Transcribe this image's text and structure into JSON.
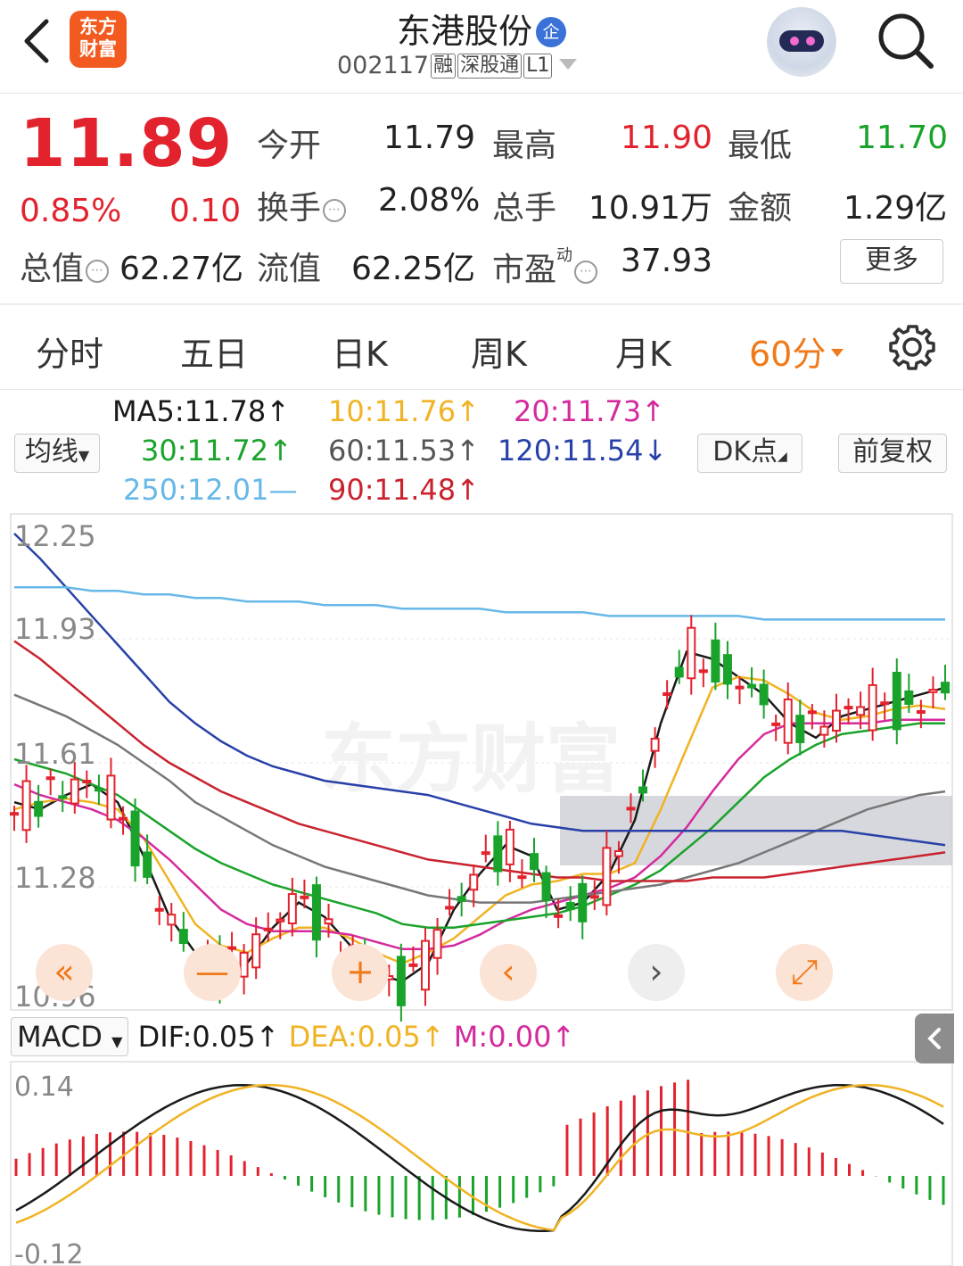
{
  "header": {
    "logo_text": "东方\n财富",
    "logo_line1": "东方",
    "logo_line2": "财富",
    "stock_name": "东港股份",
    "badge": "企",
    "code": "002117",
    "tags": [
      "融",
      "深股通",
      "L1"
    ]
  },
  "quote": {
    "price": "11.89",
    "change_pct": "0.85%",
    "change": "0.10",
    "open_label": "今开",
    "open": "11.79",
    "high_label": "最高",
    "high": "11.90",
    "low_label": "最低",
    "low": "11.70",
    "turnover_label": "换手",
    "turnover": "2.08%",
    "volume_label": "总手",
    "volume": "10.91万",
    "amount_label": "金额",
    "amount": "1.29亿",
    "mktcap_label": "总值",
    "mktcap": "62.27亿",
    "float_label": "流值",
    "float_cap": "62.25亿",
    "pe_label": "市盈",
    "pe_sup": "动",
    "pe": "37.93",
    "more_label": "更多"
  },
  "tabs": [
    {
      "label": "分时"
    },
    {
      "label": "五日"
    },
    {
      "label": "日K"
    },
    {
      "label": "周K"
    },
    {
      "label": "月K"
    },
    {
      "label": "60分"
    }
  ],
  "ma": {
    "selector": "均线",
    "ma5": "MA5:11.78↑",
    "ma10": "10:11.76↑",
    "ma20": "20:11.73↑",
    "ma30": "30:11.72↑",
    "ma60": "60:11.53↑",
    "ma120": "120:11.54↓",
    "ma250": "250:12.01—",
    "ma90": "90:11.48↑",
    "dk_button": "DK点",
    "adjust_button": "前复权"
  },
  "colors": {
    "up": "#e2232e",
    "down": "#1aa32b",
    "accent": "#f07a1a",
    "ma5": "#1a1a1a",
    "ma10": "#f0b323",
    "ma20": "#d42a9e",
    "ma30": "#1aa32b",
    "ma60": "#777777",
    "ma120": "#2841a8",
    "ma250": "#67b8e8",
    "ma90": "#c8232e"
  },
  "chart_data": [
    {
      "type": "candlestick",
      "y_ticks": [
        "12.25",
        "11.93",
        "11.28",
        "10.96"
      ],
      "y_tick_1161": "11.61",
      "ylim": [
        10.96,
        12.25
      ],
      "watermark": "东方财富",
      "series": [
        {
          "name": "MA5",
          "values": [
            11.5,
            11.48,
            11.52,
            11.55,
            11.5,
            11.35,
            11.18,
            11.08,
            11.02,
            11.05,
            11.15,
            11.22,
            11.18,
            11.1,
            11.02,
            11.0,
            11.05,
            11.2,
            11.3,
            11.38,
            11.35,
            11.2,
            11.22,
            11.3,
            11.45,
            11.72,
            11.92,
            11.9,
            11.85,
            11.8,
            11.72,
            11.68,
            11.74,
            11.76,
            11.78,
            11.8,
            11.82
          ]
        },
        {
          "name": "MA10",
          "values": [
            11.48,
            11.5,
            11.51,
            11.5,
            11.48,
            11.4,
            11.28,
            11.16,
            11.1,
            11.08,
            11.12,
            11.15,
            11.15,
            11.12,
            11.08,
            11.05,
            11.08,
            11.12,
            11.18,
            11.24,
            11.27,
            11.28,
            11.3,
            11.3,
            11.33,
            11.48,
            11.65,
            11.82,
            11.85,
            11.84,
            11.8,
            11.75,
            11.73,
            11.74,
            11.76,
            11.77,
            11.76
          ]
        },
        {
          "name": "MA20",
          "values": [
            11.55,
            11.52,
            11.5,
            11.48,
            11.45,
            11.4,
            11.34,
            11.27,
            11.2,
            11.16,
            11.14,
            11.14,
            11.14,
            11.13,
            11.11,
            11.09,
            11.09,
            11.1,
            11.13,
            11.17,
            11.2,
            11.22,
            11.24,
            11.26,
            11.29,
            11.35,
            11.43,
            11.53,
            11.62,
            11.69,
            11.72,
            11.72,
            11.72,
            11.72,
            11.73,
            11.73,
            11.73
          ]
        },
        {
          "name": "MA30",
          "values": [
            11.62,
            11.6,
            11.58,
            11.55,
            11.52,
            11.47,
            11.42,
            11.37,
            11.33,
            11.3,
            11.27,
            11.25,
            11.23,
            11.21,
            11.19,
            11.16,
            11.15,
            11.15,
            11.16,
            11.17,
            11.18,
            11.19,
            11.21,
            11.24,
            11.27,
            11.31,
            11.37,
            11.43,
            11.5,
            11.57,
            11.62,
            11.66,
            11.69,
            11.7,
            11.71,
            11.72,
            11.72
          ]
        },
        {
          "name": "MA60",
          "values": [
            11.8,
            11.77,
            11.74,
            11.7,
            11.66,
            11.61,
            11.56,
            11.5,
            11.46,
            11.42,
            11.38,
            11.35,
            11.32,
            11.3,
            11.28,
            11.26,
            11.24,
            11.23,
            11.22,
            11.22,
            11.22,
            11.23,
            11.24,
            11.25,
            11.26,
            11.27,
            11.29,
            11.31,
            11.33,
            11.36,
            11.39,
            11.42,
            11.45,
            11.48,
            11.5,
            11.52,
            11.53
          ]
        },
        {
          "name": "MA90",
          "values": [
            11.95,
            11.9,
            11.84,
            11.78,
            11.72,
            11.66,
            11.61,
            11.57,
            11.53,
            11.5,
            11.47,
            11.44,
            11.42,
            11.4,
            11.38,
            11.36,
            11.34,
            11.33,
            11.32,
            11.31,
            11.3,
            11.29,
            11.29,
            11.28,
            11.28,
            11.28,
            11.28,
            11.29,
            11.29,
            11.29,
            11.3,
            11.31,
            11.32,
            11.33,
            11.34,
            11.35,
            11.36
          ]
        },
        {
          "name": "MA120",
          "values": [
            12.25,
            12.18,
            12.1,
            12.02,
            11.94,
            11.86,
            11.78,
            11.72,
            11.67,
            11.63,
            11.6,
            11.58,
            11.56,
            11.55,
            11.54,
            11.53,
            11.52,
            11.5,
            11.48,
            11.46,
            11.44,
            11.43,
            11.42,
            11.42,
            11.42,
            11.42,
            11.42,
            11.42,
            11.42,
            11.42,
            11.42,
            11.42,
            11.42,
            11.41,
            11.4,
            11.39,
            11.38
          ]
        },
        {
          "name": "MA250",
          "values": [
            12.1,
            12.1,
            12.1,
            12.09,
            12.09,
            12.08,
            12.08,
            12.07,
            12.07,
            12.06,
            12.06,
            12.06,
            12.05,
            12.05,
            12.05,
            12.04,
            12.04,
            12.04,
            12.04,
            12.03,
            12.03,
            12.03,
            12.03,
            12.02,
            12.02,
            12.02,
            12.02,
            12.02,
            12.02,
            12.01,
            12.01,
            12.01,
            12.01,
            12.01,
            12.01,
            12.01,
            12.01
          ]
        }
      ]
    },
    {
      "type": "bar",
      "title": "MACD",
      "dif": "DIF:0.05↑",
      "dea": "DEA:0.05↑",
      "m": "M:0.00↑",
      "y_ticks": [
        "0.14",
        "-0.12"
      ],
      "ylim": [
        -0.12,
        0.14
      ]
    }
  ]
}
